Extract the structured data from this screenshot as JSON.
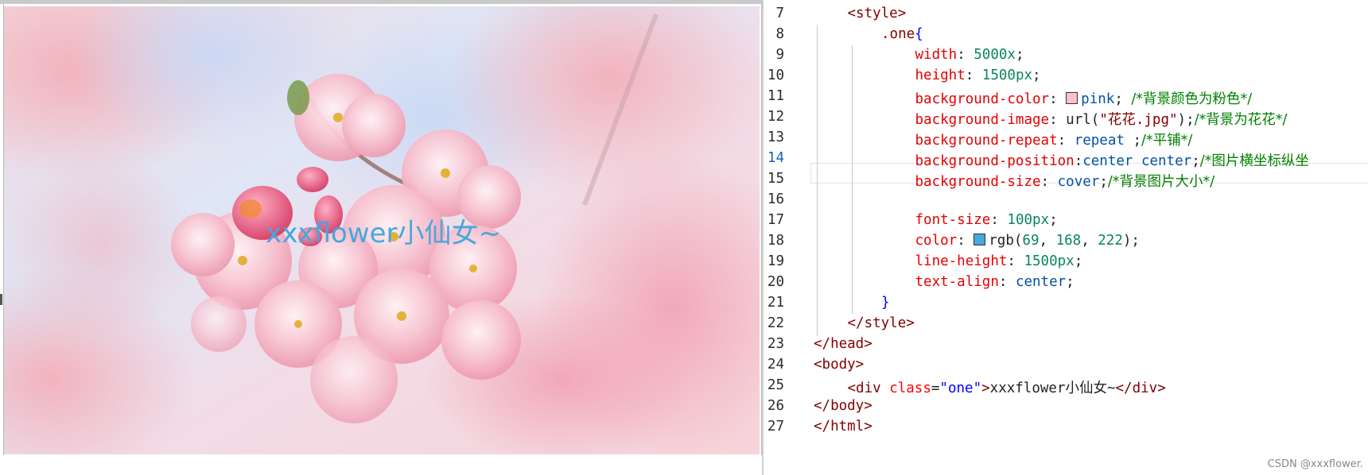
{
  "preview": {
    "rendered_text": "xxxflower小仙女~",
    "text_color": "#45a8de"
  },
  "editor": {
    "lines": [
      {
        "num": "7",
        "parts": [
          {
            "t": "<style>",
            "c": "tag"
          }
        ]
      },
      {
        "num": "8",
        "parts": [
          {
            "t": ".one",
            "c": "sel"
          },
          {
            "t": "{",
            "c": "brace"
          }
        ]
      },
      {
        "num": "9",
        "parts": [
          {
            "t": "width",
            "c": "prop"
          },
          {
            "t": ": ",
            "c": "plain"
          },
          {
            "t": "5000x",
            "c": "num"
          },
          {
            "t": ";",
            "c": "plain"
          }
        ]
      },
      {
        "num": "10",
        "parts": [
          {
            "t": "height",
            "c": "prop"
          },
          {
            "t": ": ",
            "c": "plain"
          },
          {
            "t": "1500px",
            "c": "num"
          },
          {
            "t": ";",
            "c": "plain"
          }
        ]
      },
      {
        "num": "11",
        "parts": [
          {
            "t": "background-color",
            "c": "prop"
          },
          {
            "t": ": ",
            "c": "plain"
          },
          {
            "swatch": "#ffc0cb"
          },
          {
            "t": "pink",
            "c": "val"
          },
          {
            "t": "; ",
            "c": "plain"
          },
          {
            "t": "/*背景颜色为粉色*/",
            "c": "cm"
          }
        ]
      },
      {
        "num": "12",
        "parts": [
          {
            "t": "background-image",
            "c": "prop"
          },
          {
            "t": ": ",
            "c": "plain"
          },
          {
            "t": "url(",
            "c": "plain"
          },
          {
            "t": "\"花花.jpg\"",
            "c": "tag"
          },
          {
            "t": ");",
            "c": "plain"
          },
          {
            "t": "/*背景为花花*/",
            "c": "cm"
          }
        ]
      },
      {
        "num": "13",
        "parts": [
          {
            "t": "background-repeat",
            "c": "prop"
          },
          {
            "t": ": ",
            "c": "plain"
          },
          {
            "t": "repeat",
            "c": "val"
          },
          {
            "t": " ;",
            "c": "plain"
          },
          {
            "t": "/*平铺*/",
            "c": "cm"
          }
        ]
      },
      {
        "num": "14",
        "active": true,
        "parts": [
          {
            "t": "background-position",
            "c": "prop"
          },
          {
            "t": ":",
            "c": "plain"
          },
          {
            "t": "center center",
            "c": "val"
          },
          {
            "t": ";",
            "c": "plain"
          },
          {
            "t": "/*图片横坐标纵坐",
            "c": "cm"
          }
        ]
      },
      {
        "num": "15",
        "parts": [
          {
            "t": "background-size",
            "c": "prop"
          },
          {
            "t": ": ",
            "c": "plain"
          },
          {
            "t": "cover",
            "c": "val"
          },
          {
            "t": ";",
            "c": "plain"
          },
          {
            "t": "/*背景图片大小*/",
            "c": "cm"
          }
        ]
      },
      {
        "num": "16",
        "parts": []
      },
      {
        "num": "17",
        "parts": [
          {
            "t": "font-size",
            "c": "prop"
          },
          {
            "t": ": ",
            "c": "plain"
          },
          {
            "t": "100px",
            "c": "num"
          },
          {
            "t": ";",
            "c": "plain"
          }
        ]
      },
      {
        "num": "18",
        "parts": [
          {
            "t": "color",
            "c": "prop"
          },
          {
            "t": ": ",
            "c": "plain"
          },
          {
            "swatch": "#45a8de"
          },
          {
            "t": "rgb(",
            "c": "plain"
          },
          {
            "t": "69",
            "c": "num"
          },
          {
            "t": ", ",
            "c": "plain"
          },
          {
            "t": "168",
            "c": "num"
          },
          {
            "t": ", ",
            "c": "plain"
          },
          {
            "t": "222",
            "c": "num"
          },
          {
            "t": ");",
            "c": "plain"
          }
        ]
      },
      {
        "num": "19",
        "parts": [
          {
            "t": "line-height",
            "c": "prop"
          },
          {
            "t": ": ",
            "c": "plain"
          },
          {
            "t": "1500px",
            "c": "num"
          },
          {
            "t": ";",
            "c": "plain"
          }
        ]
      },
      {
        "num": "20",
        "parts": [
          {
            "t": "text-align",
            "c": "prop"
          },
          {
            "t": ": ",
            "c": "plain"
          },
          {
            "t": "center",
            "c": "val"
          },
          {
            "t": ";",
            "c": "plain"
          }
        ]
      },
      {
        "num": "21",
        "parts": [
          {
            "t": "}",
            "c": "brace"
          }
        ]
      },
      {
        "num": "22",
        "parts": [
          {
            "t": "</style>",
            "c": "tag"
          }
        ]
      },
      {
        "num": "23",
        "parts": [
          {
            "t": "</head>",
            "c": "tag"
          }
        ]
      },
      {
        "num": "24",
        "parts": [
          {
            "t": "<body>",
            "c": "tag"
          }
        ]
      },
      {
        "num": "25",
        "parts": [
          {
            "t": "<div ",
            "c": "tag"
          },
          {
            "t": "class",
            "c": "kw-attr"
          },
          {
            "t": "=",
            "c": "plain"
          },
          {
            "t": "\"one\"",
            "c": "attr-val"
          },
          {
            "t": ">",
            "c": "tag"
          },
          {
            "t": "xxxflower小仙女~",
            "c": "plain"
          },
          {
            "t": "</div>",
            "c": "tag"
          }
        ]
      },
      {
        "num": "26",
        "parts": [
          {
            "t": "</body>",
            "c": "tag"
          }
        ]
      },
      {
        "num": "27",
        "parts": [
          {
            "t": "</html>",
            "c": "tag"
          }
        ]
      }
    ]
  },
  "watermark": "CSDN @xxxflower."
}
